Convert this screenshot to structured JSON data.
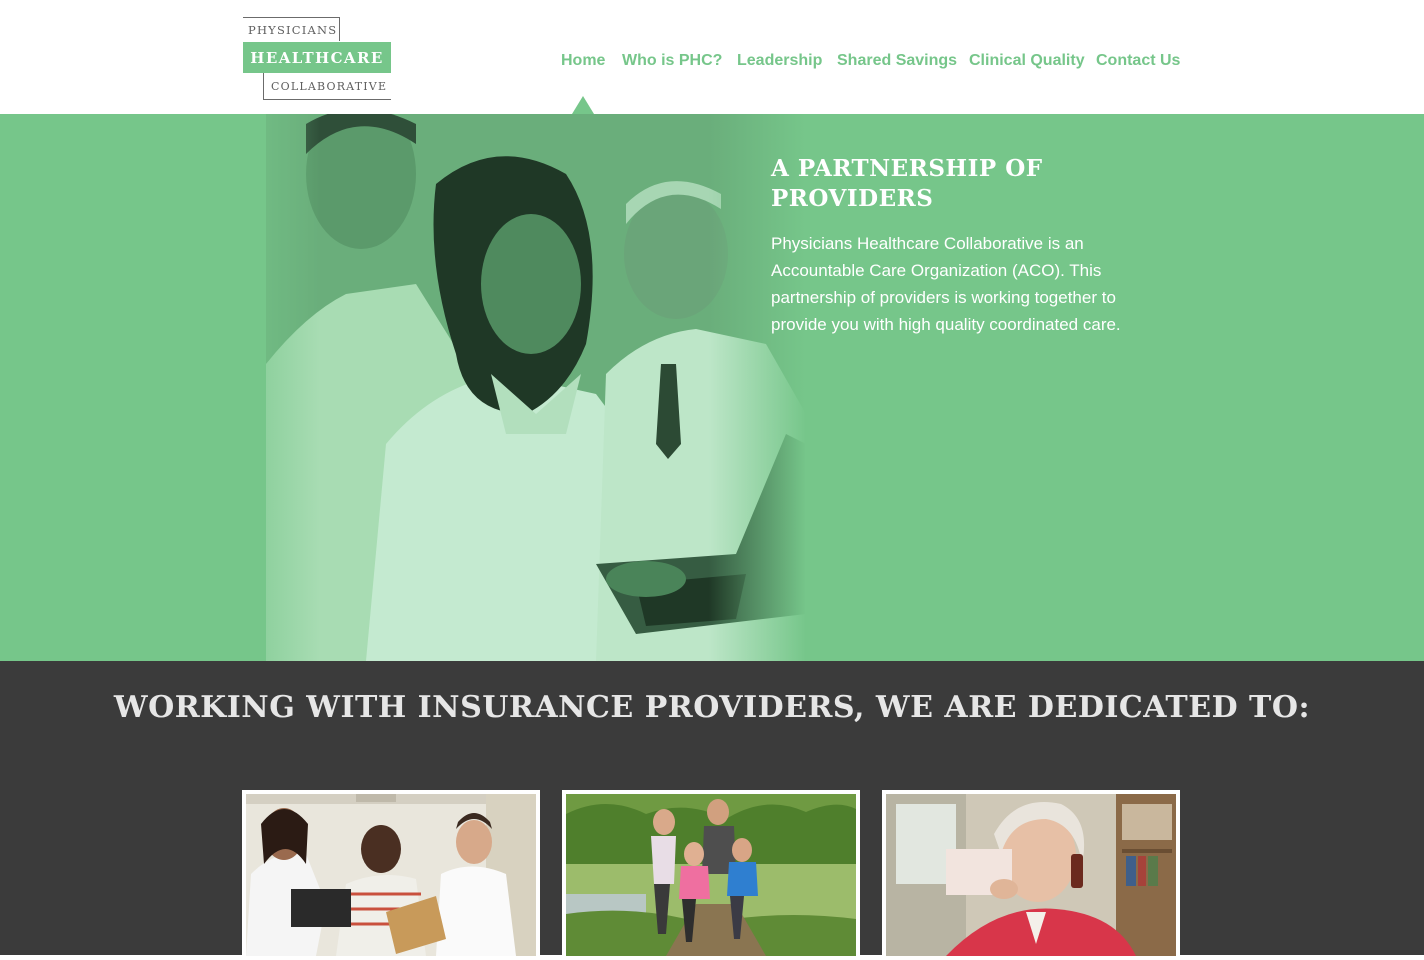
{
  "logo": {
    "line1": "PHYSICIANS",
    "line2": "HEALTHCARE",
    "line3": "COLLABORATIVE"
  },
  "nav": {
    "items": [
      "Home",
      "Who is PHC?",
      "Leadership",
      "Shared Savings",
      "Clinical Quality",
      "Contact Us"
    ],
    "active": "Home"
  },
  "hero": {
    "title": "A PARTNERSHIP OF PROVIDERS",
    "text": "Physicians Healthcare Collaborative is an Accountable Care Organization (ACO). This partnership of providers is working together to provide you with high quality coordinated care."
  },
  "section": {
    "title": "WORKING WITH INSURANCE PROVIDERS, WE ARE DEDICATED TO:"
  },
  "cards": [
    {
      "image": "doctors-with-patient-photo"
    },
    {
      "image": "family-running-photo"
    },
    {
      "image": "senior-woman-on-phone-photo"
    }
  ],
  "colors": {
    "accent": "#76c68a",
    "dark": "#3b3b3b",
    "logo_text": "#5f5f5f"
  }
}
